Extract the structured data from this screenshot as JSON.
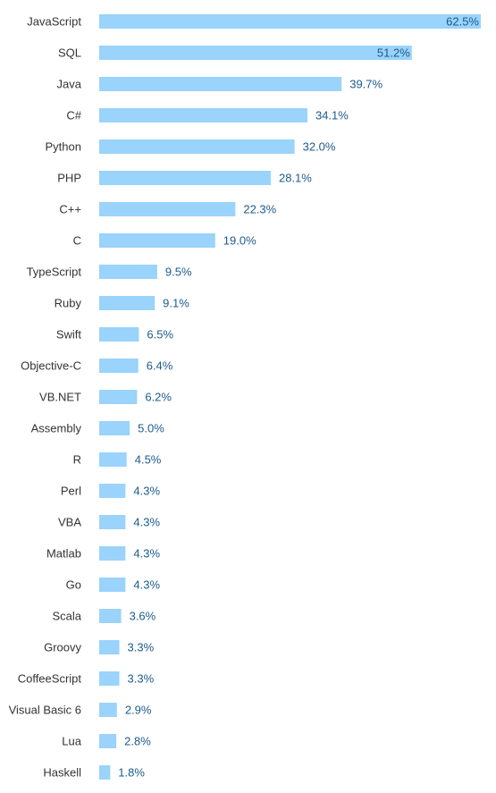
{
  "chart_data": {
    "type": "bar",
    "orientation": "horizontal",
    "title": "",
    "xlabel": "",
    "ylabel": "",
    "xlim": [
      0,
      62.5
    ],
    "grid": false,
    "legend": "none",
    "value_suffix": "%",
    "colors": {
      "bar": "#9ad3fc",
      "value_label": "#1d5b8c",
      "category_label": "#333333"
    },
    "categories": [
      "JavaScript",
      "SQL",
      "Java",
      "C#",
      "Python",
      "PHP",
      "C++",
      "C",
      "TypeScript",
      "Ruby",
      "Swift",
      "Objective-C",
      "VB.NET",
      "Assembly",
      "R",
      "Perl",
      "VBA",
      "Matlab",
      "Go",
      "Scala",
      "Groovy",
      "CoffeeScript",
      "Visual Basic 6",
      "Lua",
      "Haskell"
    ],
    "values": [
      62.5,
      51.2,
      39.7,
      34.1,
      32.0,
      28.1,
      22.3,
      19.0,
      9.5,
      9.1,
      6.5,
      6.4,
      6.2,
      5.0,
      4.5,
      4.3,
      4.3,
      4.3,
      4.3,
      3.6,
      3.3,
      3.3,
      2.9,
      2.8,
      1.8
    ],
    "labels": [
      "62.5%",
      "51.2%",
      "39.7%",
      "34.1%",
      "32.0%",
      "28.1%",
      "22.3%",
      "19.0%",
      "9.5%",
      "9.1%",
      "6.5%",
      "6.4%",
      "6.2%",
      "5.0%",
      "4.5%",
      "4.3%",
      "4.3%",
      "4.3%",
      "4.3%",
      "3.6%",
      "3.3%",
      "3.3%",
      "2.9%",
      "2.8%",
      "1.8%"
    ]
  }
}
